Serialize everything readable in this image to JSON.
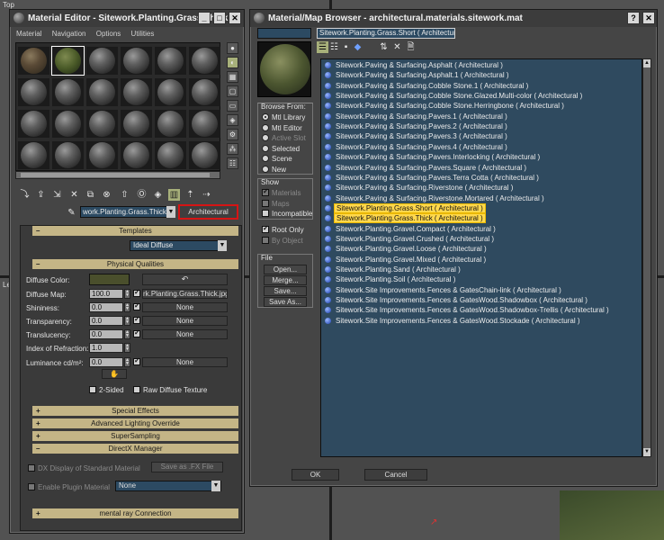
{
  "viewport": {
    "label_top": "Top",
    "label_left": "Le"
  },
  "mat_editor": {
    "title": "Material Editor - Sitework.Planting.Grass.Thick",
    "menu": [
      "Material",
      "Navigation",
      "Options",
      "Utilities"
    ],
    "current_name": "work.Planting.Grass.Thick",
    "type_button": "Architectural",
    "templates": {
      "header": "Templates",
      "value": "Ideal Diffuse"
    },
    "physical": {
      "header": "Physical Qualities",
      "diffuse_color": "Diffuse Color:",
      "diffuse_map": "Diffuse Map:",
      "diffuse_map_val": "100.0",
      "diffuse_map_name": "rk.Planting.Grass.Thick.jpg)",
      "shininess": "Shininess:",
      "shininess_val": "0.0",
      "shininess_map": "None",
      "transparency": "Transparency:",
      "transparency_val": "0.0",
      "transparency_map": "None",
      "translucency": "Translucency:",
      "translucency_val": "0.0",
      "translucency_map": "None",
      "ior": "Index of Refraction:",
      "ior_val": "1.0",
      "luminance": "Luminance cd/m²:",
      "luminance_val": "0.0",
      "luminance_map": "None",
      "two_sided": "2-Sided",
      "raw_diffuse": "Raw Diffuse Texture"
    },
    "special_effects": "Special Effects",
    "adv_lighting": "Advanced Lighting Override",
    "supersampling": "SuperSampling",
    "directx": {
      "header": "DirectX Manager",
      "dx_display": "DX Display of Standard Material",
      "save_fx": "Save as .FX File",
      "enable_plugin": "Enable Plugin Material",
      "plugin_value": "None"
    },
    "mental_ray": "mental ray Connection"
  },
  "browser": {
    "title": "Material/Map Browser - architectural.materials.sitework.mat",
    "name_field": "Sitework.Planting.Grass.Short  ( Architectural",
    "browse_from": {
      "label": "Browse From:",
      "options": [
        "Mtl Library",
        "Mtl Editor",
        "Active Slot",
        "Selected",
        "Scene",
        "New"
      ],
      "selected": 0
    },
    "show": {
      "label": "Show",
      "options": [
        "Materials",
        "Maps",
        "Incompatible"
      ]
    },
    "root_only": "Root Only",
    "by_object": "By Object",
    "file": {
      "label": "File",
      "buttons": [
        "Open...",
        "Merge...",
        "Save...",
        "Save As..."
      ]
    },
    "items": [
      "Sitework.Paving & Surfacing.Asphalt  ( Architectural )",
      "Sitework.Paving & Surfacing.Asphalt.1  ( Architectural )",
      "Sitework.Paving & Surfacing.Cobble Stone.1  ( Architectural )",
      "Sitework.Paving & Surfacing.Cobble Stone.Glazed.Multi-color  ( Architectural )",
      "Sitework.Paving & Surfacing.Cobble Stone.Herringbone  ( Architectural )",
      "Sitework.Paving & Surfacing.Pavers.1  ( Architectural )",
      "Sitework.Paving & Surfacing.Pavers.2  ( Architectural )",
      "Sitework.Paving & Surfacing.Pavers.3  ( Architectural )",
      "Sitework.Paving & Surfacing.Pavers.4  ( Architectural )",
      "Sitework.Paving & Surfacing.Pavers.Interlocking  ( Architectural )",
      "Sitework.Paving & Surfacing.Pavers.Square  ( Architectural )",
      "Sitework.Paving & Surfacing.Pavers.Terra Cotta  ( Architectural )",
      "Sitework.Paving & Surfacing.Riverstone  ( Architectural )",
      "Sitework.Paving & Surfacing.Riverstone.Mortared  ( Architectural )",
      "Sitework.Planting.Grass.Short  ( Architectural )",
      "Sitework.Planting.Grass.Thick  ( Architectural )",
      "Sitework.Planting.Gravel.Compact  ( Architectural )",
      "Sitework.Planting.Gravel.Crushed  ( Architectural )",
      "Sitework.Planting.Gravel.Loose  ( Architectural )",
      "Sitework.Planting.Gravel.Mixed  ( Architectural )",
      "Sitework.Planting.Sand  ( Architectural )",
      "Sitework.Planting.Soil  ( Architectural )",
      "Sitework.Site Improvements.Fences & GatesChain-link  ( Architectural )",
      "Sitework.Site Improvements.Fences & GatesWood.Shadowbox  ( Architectural )",
      "Sitework.Site Improvements.Fences & GatesWood.Shadowbox-Trellis  ( Architectural )",
      "Sitework.Site Improvements.Fences & GatesWood.Stockade  ( Architectural )"
    ],
    "selected": [
      14,
      15
    ],
    "ok": "OK",
    "cancel": "Cancel"
  }
}
